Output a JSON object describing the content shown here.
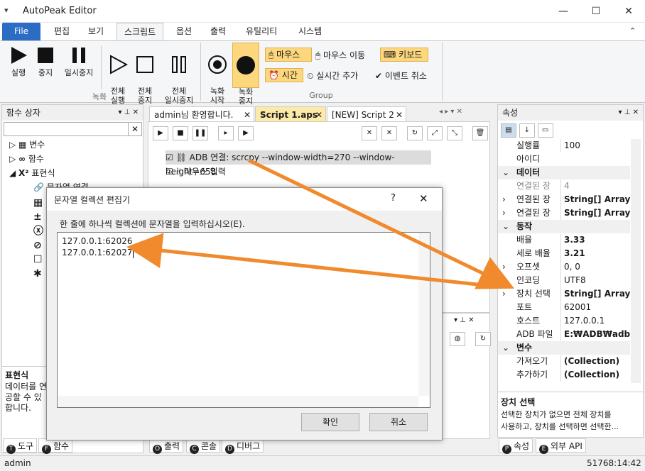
{
  "window": {
    "title": "AutoPeak Editor"
  },
  "menu_tabs": [
    "File",
    "편집",
    "보기",
    "스크립트",
    "옵션",
    "출력",
    "유틸리티",
    "시스템"
  ],
  "ribbon": {
    "record_group": {
      "buttons": [
        "실행",
        "중지",
        "일시중지",
        "전체\n실행",
        "전체\n중지",
        "전체\n일시중지"
      ],
      "label": "녹화"
    },
    "group": {
      "rec_start": "녹화\n시작",
      "rec_stop": "녹화\n중지",
      "mouse": "마우스",
      "mouse_move": "마우스 이동",
      "keyboard": "키보드",
      "time": "시간",
      "realtime_add": "실시간 추가",
      "event_cancel": "이벤트 취소",
      "label": "Group"
    }
  },
  "func_box": {
    "title": "함수 상자",
    "tree": [
      "변수",
      "함수",
      "표현식",
      "문자열 연결"
    ],
    "desc_title": "표현식",
    "desc_text": "데이터를 연\n공할 수 있\n합니다."
  },
  "doc_tabs": [
    "admin님 환영합니다.",
    "Script 1.aps",
    "[NEW] Script 2"
  ],
  "script_lines": [
    {
      "label": "ADB 연결:",
      "detail": " scrcpy --window-width=270 --window-height=658"
    },
    {
      "label": "마우스 입력",
      "detail": ""
    }
  ],
  "dialog": {
    "title": "문자열 컬렉션 편집기",
    "help": "?",
    "prompt": "한 줄에 하나씩 컬렉션에 문자열을 입력하십시오(E).",
    "lines": [
      "127.0.0.1:62026",
      "127.0.0.1:62027"
    ],
    "ok": "확인",
    "cancel": "취소"
  },
  "properties": {
    "title": "속성",
    "rows": [
      {
        "name": "실행률",
        "value": "100",
        "bold": false
      },
      {
        "name": "아이디",
        "value": "",
        "bold": false
      },
      {
        "name": "데이터",
        "value": "",
        "cat": true
      },
      {
        "name": "연결된 장",
        "value": "4",
        "bold": false,
        "gray": true
      },
      {
        "name": "연결된 장",
        "value": "String[] Array",
        "bold": true,
        "exp": true
      },
      {
        "name": "연결된 장",
        "value": "String[] Array",
        "bold": true,
        "exp": true
      },
      {
        "name": "동작",
        "value": "",
        "cat": true
      },
      {
        "name": "배율",
        "value": "3.33",
        "bold": true
      },
      {
        "name": "세로 배율",
        "value": "3.21",
        "bold": true
      },
      {
        "name": "오프셋",
        "value": "0, 0",
        "bold": false,
        "exp": true
      },
      {
        "name": "인코딩",
        "value": "UTF8",
        "bold": false
      },
      {
        "name": "장치 선택",
        "value": "String[] Array",
        "bold": true,
        "exp": true
      },
      {
        "name": "포트",
        "value": "62001",
        "bold": false
      },
      {
        "name": "호스트",
        "value": "127.0.0.1",
        "bold": false
      },
      {
        "name": "ADB 파일",
        "value": "E:₩ADB₩adb.exe",
        "bold": true
      },
      {
        "name": "변수",
        "value": "",
        "cat": true
      },
      {
        "name": "가져오기",
        "value": "(Collection)",
        "bold": true
      },
      {
        "name": "추가하기",
        "value": "(Collection)",
        "bold": true
      }
    ],
    "desc_title": "장치 선택",
    "desc_text": "선택한 장치가 없으면 전체 장치를\n사용하고, 장치를 선택하면 선택한..."
  },
  "bottom_tabs_left": [
    "도구",
    "함수"
  ],
  "bottom_tabs_mid": [
    "출력",
    "콘솔",
    "디버그"
  ],
  "bottom_tabs_right": [
    "속성",
    "외부 API"
  ],
  "status": {
    "user": "admin",
    "time": "51768:14:42"
  },
  "colors": {
    "accent": "#2b6cc4",
    "arrow": "#f08a2c",
    "highlight": "#fcd77e"
  }
}
